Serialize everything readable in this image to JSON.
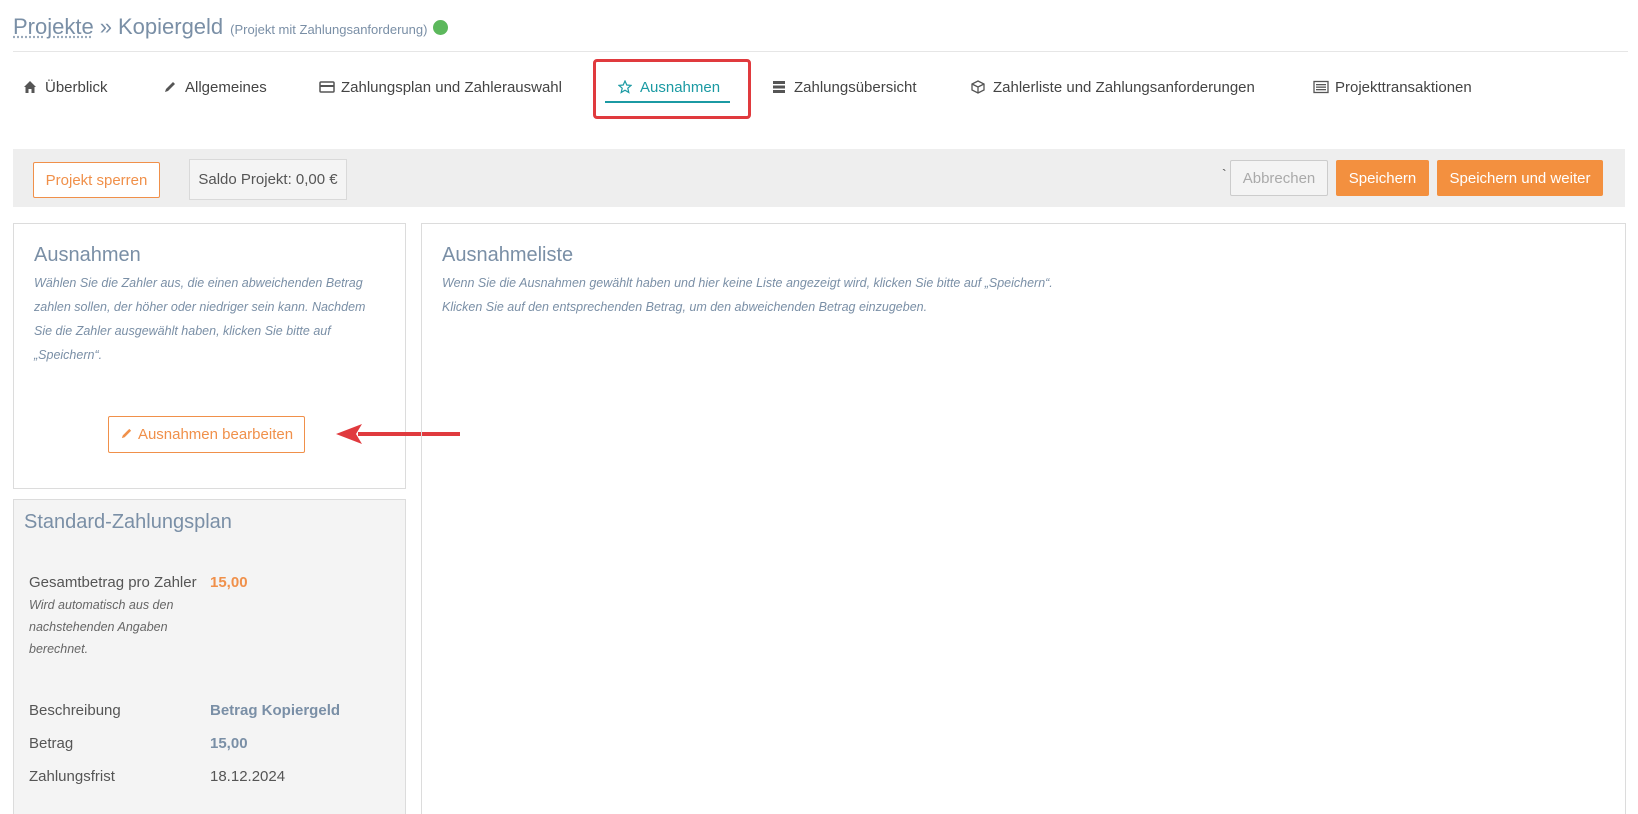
{
  "header": {
    "breadcrumb_link": "Projekte",
    "separator": "»",
    "current": "Kopiergeld",
    "subtitle": "(Projekt mit Zahlungsanforderung)",
    "status_color": "#5cb85c"
  },
  "tabs": [
    {
      "label": "Überblick",
      "icon": "home-icon"
    },
    {
      "label": "Allgemeines",
      "icon": "pencil-icon"
    },
    {
      "label": "Zahlungsplan und Zahlerauswahl",
      "icon": "credit-card-icon"
    },
    {
      "label": "Ausnahmen",
      "icon": "star-icon",
      "active": true
    },
    {
      "label": "Zahlungsübersicht",
      "icon": "server-icon"
    },
    {
      "label": "Zahlerliste und Zahlungsanforderungen",
      "icon": "cube-icon"
    },
    {
      "label": "Projekttransaktionen",
      "icon": "list-alt-icon"
    }
  ],
  "actions": {
    "lock_label": "Projekt sperren",
    "saldo_label": "Saldo Projekt: 0,00 €",
    "tick": "`",
    "cancel_label": "Abbrechen",
    "save_label": "Speichern",
    "save_next_label": "Speichern und weiter",
    "accent_color": "#f3903f"
  },
  "exceptions_panel": {
    "title": "Ausnahmen",
    "note_lines": [
      "Wählen Sie die Zahler aus, die einen abweichenden Betrag",
      "zahlen sollen, der höher oder niedriger sein kann. Nachdem",
      "Sie die Zahler ausgewählt haben, klicken Sie bitte auf",
      "„Speichern“."
    ],
    "edit_button_label": "Ausnahmen bearbeiten"
  },
  "exceptions_list": {
    "title": "Ausnahmeliste",
    "note_lines": [
      "Wenn Sie die Ausnahmen gewählt haben und hier keine Liste angezeigt wird, klicken Sie bitte auf „Speichern“.",
      "Klicken Sie auf den entsprechenden Betrag, um den abweichenden Betrag einzugeben."
    ]
  },
  "payment_plan": {
    "title": "Standard-Zahlungsplan",
    "total_label": "Gesamtbetrag pro Zahler",
    "total_value": "15,00",
    "total_hint_lines": [
      "Wird automatisch aus den",
      "nachstehenden Angaben",
      "berechnet."
    ],
    "description_label": "Beschreibung",
    "description_value": "Betrag Kopiergeld",
    "amount_label": "Betrag",
    "amount_value": "15,00",
    "due_label": "Zahlungsfrist",
    "due_value": "18.12.2024"
  }
}
